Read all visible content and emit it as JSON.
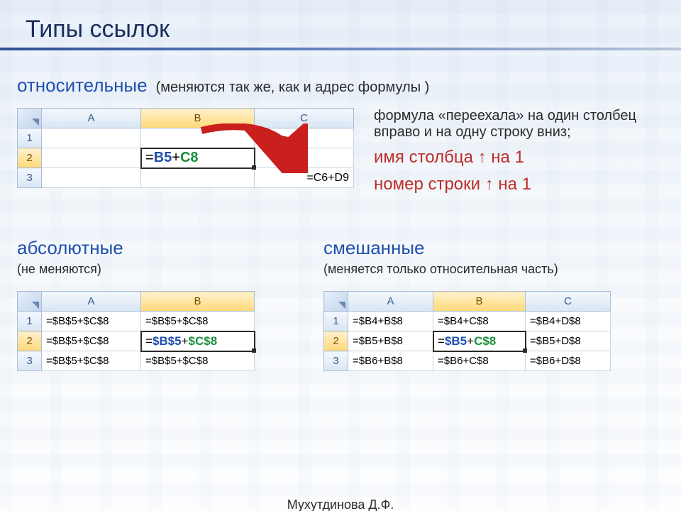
{
  "title": "Типы ссылок",
  "section1": {
    "heading": "относительные",
    "note": "(меняются так же, как и адрес формулы )",
    "right_p1": "формула «переехала» на один столбец вправо и на одну строку вниз;",
    "right_p2a": "имя столбца ",
    "right_p2b": " на 1",
    "right_p3a": "номер строки ",
    "right_p3b": " на 1",
    "arrow_glyph": "↑"
  },
  "sheet_rel": {
    "cols": [
      "A",
      "B",
      "C"
    ],
    "rows": [
      "1",
      "2",
      "3"
    ],
    "b2_prefix": "=",
    "b2_ref1": "B5",
    "b2_plus": "+",
    "b2_ref2": "C8",
    "c3": "=C6+D9"
  },
  "section2": {
    "heading": "абсолютные",
    "note": "(не меняются)"
  },
  "sheet_abs": {
    "cols": [
      "A",
      "B"
    ],
    "rows": [
      "1",
      "2",
      "3"
    ],
    "r1a": "=$B$5+$C$8",
    "r1b": "=$B$5+$C$8",
    "r2a": "=$B$5+$C$8",
    "r2b_prefix": "=",
    "r2b_ref1": "$B$5",
    "r2b_plus": "+",
    "r2b_ref2": "$C$8",
    "r3a": "=$B$5+$C$8",
    "r3b": "=$B$5+$C$8"
  },
  "section3": {
    "heading": "смешанные",
    "note": "(меняется только относительная часть)"
  },
  "sheet_mix": {
    "cols": [
      "A",
      "B",
      "C"
    ],
    "rows": [
      "1",
      "2",
      "3"
    ],
    "r1a": "=$B4+B$8",
    "r1b": "=$B4+C$8",
    "r1c": "=$B4+D$8",
    "r2a": "=$B5+B$8",
    "r2b_prefix": "=",
    "r2b_ref1": "$B5",
    "r2b_plus": "+",
    "r2b_ref2": "C$8",
    "r2c": "=$B5+D$8",
    "r3a": "=$B6+B$8",
    "r3b": "=$B6+C$8",
    "r3c": "=$B6+D$8"
  },
  "footer": "Мухутдинова Д.Ф."
}
